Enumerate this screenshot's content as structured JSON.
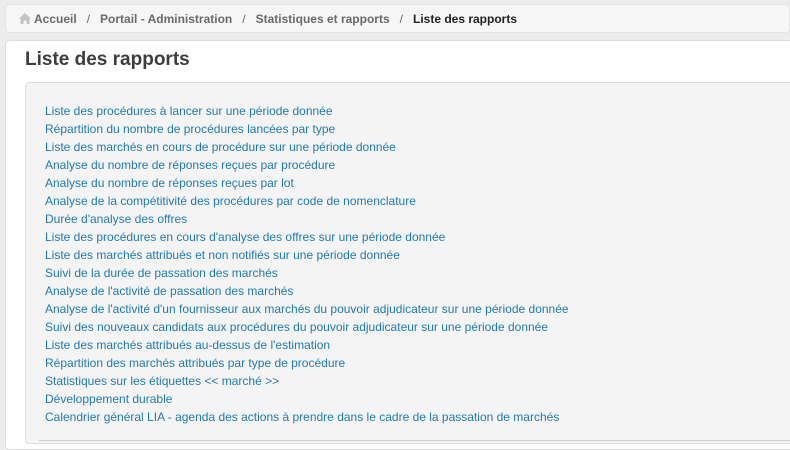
{
  "breadcrumb": {
    "home": "Accueil",
    "portal": "Portail - Administration",
    "stats": "Statistiques et rapports",
    "current": "Liste des rapports",
    "separator": "/"
  },
  "page": {
    "title": "Liste des rapports"
  },
  "reports": [
    "Liste des procédures à lancer sur une période donnée",
    "Répartition du nombre de procédures lancées par type",
    "Liste des marchés en cours de procédure sur une période donnée",
    "Analyse du nombre de réponses reçues par procédure",
    "Analyse du nombre de réponses reçues par lot",
    "Analyse de la compétitivité des procédures par code de nomenclature",
    "Durée d'analyse des offres",
    "Liste des procédures en cours d'analyse des offres sur une période donnée",
    "Liste des marchés attribués et non notifiés sur une période donnée",
    "Suivi de la durée de passation des marchés",
    "Analyse de l'activité de passation des marchés",
    "Analyse de l'activité d'un fournisseur aux marchés du pouvoir adjudicateur sur une période donnée",
    "Suivi des nouveaux candidats aux procédures du pouvoir adjudicateur sur une période donnée",
    "Liste des marchés attribués au-dessus de l'estimation",
    "Répartition des marchés attribués par type de procédure",
    "Statistiques sur les étiquettes << marché >>",
    "Développement durable",
    "Calendrier général LIA - agenda des actions à prendre dans le cadre de la passation de marchés"
  ],
  "icons": {
    "home": "home-icon"
  },
  "colors": {
    "link": "#1f7ab6",
    "title": "#3d3d3d"
  }
}
